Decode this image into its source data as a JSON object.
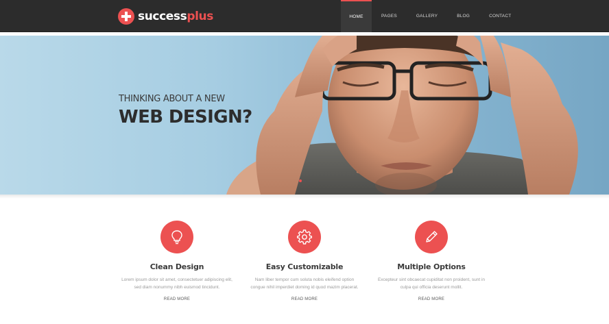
{
  "brand": {
    "name_part1": "success",
    "name_part2": "plus",
    "accent_color": "#ec5151",
    "navbar_bg": "#2c2c2c"
  },
  "nav": {
    "items": [
      {
        "label": "HOME",
        "active": true
      },
      {
        "label": "PAGES",
        "active": false
      },
      {
        "label": "GALLERY",
        "active": false
      },
      {
        "label": "BLOG",
        "active": false
      },
      {
        "label": "CONTACT",
        "active": false
      }
    ]
  },
  "hero": {
    "subtitle": "THINKING ABOUT A NEW",
    "title": "WEB DESIGN?",
    "slides": 3,
    "active_slide": 1
  },
  "features": [
    {
      "icon": "lightbulb-icon",
      "title": "Clean Design",
      "text_line1": "Lorem ipsum dolor sit amet, consectetuer adipiscing elit,",
      "text_line2": "sed diam nonummy nibh euismod tincidunt.",
      "link": "READ MORE"
    },
    {
      "icon": "gear-icon",
      "title": "Easy Customizable",
      "text_line1": "Nam liber tempor cum soluta nobis eleifend option",
      "text_line2": "congue nihil imperdiet doming id quod mazim placerat.",
      "link": "READ MORE"
    },
    {
      "icon": "pencil-icon",
      "title": "Multiple Options",
      "text_line1": "Excepteur sint obcaecat cupiditat non proident, sunt in",
      "text_line2": "culpa qui officia deserunt mollit.",
      "link": "READ MORE"
    }
  ]
}
